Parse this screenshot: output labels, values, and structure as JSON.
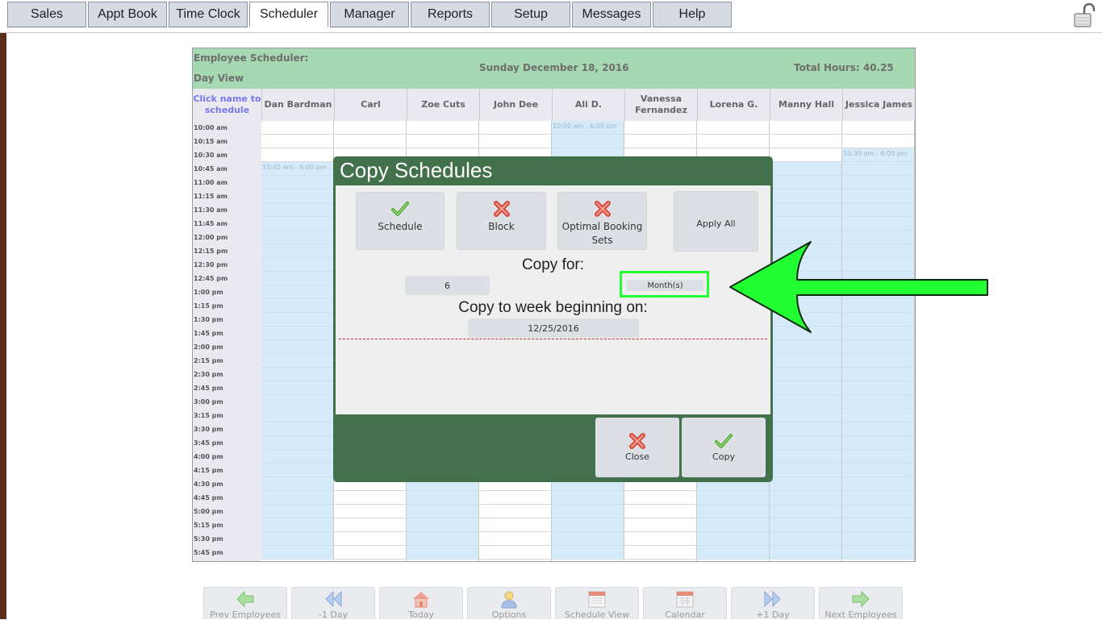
{
  "tabs": [
    {
      "label": "Sales"
    },
    {
      "label": "Appt Book"
    },
    {
      "label": "Time Clock"
    },
    {
      "label": "Scheduler",
      "active": true
    },
    {
      "label": "Manager"
    },
    {
      "label": "Reports"
    },
    {
      "label": "Setup"
    },
    {
      "label": "Messages"
    },
    {
      "label": "Help"
    }
  ],
  "scheduler": {
    "title_line1": "Employee Scheduler:",
    "title_line2": "Day View",
    "date": "Sunday December 18, 2016",
    "total_hours": "Total Hours: 40.25",
    "click_name_hint": "Click name to schedule",
    "employees": [
      "Dan Bardman",
      "Carl",
      "Zoe Cuts",
      "John Dee",
      "Ali D.",
      "Vanessa Fernandez",
      "Lorena G.",
      "Manny Hall",
      "Jessica James"
    ],
    "times": [
      "10:00 am",
      "10:15 am",
      "10:30 am",
      "10:45 am",
      "11:00 am",
      "11:15 am",
      "11:30 am",
      "11:45 am",
      "12:00 pm",
      "12:15 pm",
      "12:30 pm",
      "12:45 pm",
      "1:00 pm",
      "1:15 pm",
      "1:30 pm",
      "1:45 pm",
      "2:00 pm",
      "2:15 pm",
      "2:30 pm",
      "2:45 pm",
      "3:00 pm",
      "3:15 pm",
      "3:30 pm",
      "3:45 pm",
      "4:00 pm",
      "4:15 pm",
      "4:30 pm",
      "4:45 pm",
      "5:00 pm",
      "5:15 pm",
      "5:30 pm",
      "5:45 pm"
    ],
    "shifts": [
      {
        "employee": 0,
        "label": "10:45 am - 6:00 pm",
        "start": "10:45 am"
      },
      {
        "employee": 2,
        "label": "",
        "start": "10:45 am"
      },
      {
        "employee": 4,
        "label": "10:00 am - 6:00 pm",
        "start": "10:00 am"
      },
      {
        "employee": 6,
        "label": "",
        "start": "10:45 am"
      },
      {
        "employee": 7,
        "label": "",
        "start": "10:45 am"
      },
      {
        "employee": 8,
        "label": "10:30 am - 6:00 pm",
        "start": "10:30 am"
      }
    ]
  },
  "dialog": {
    "title": "Copy Schedules",
    "options": {
      "schedule": "Schedule",
      "block": "Block",
      "optimal_booking_line1": "Optimal Booking",
      "optimal_booking_line2": "Sets",
      "apply_all": "Apply All"
    },
    "copy_for_label": "Copy for:",
    "copy_for_value": "6",
    "copy_for_unit": "Month(s)",
    "copy_to_label": "Copy to week beginning on:",
    "copy_to_value": "12/25/2016",
    "close_label": "Close",
    "copy_label": "Copy"
  },
  "nav": {
    "prev_employees": "Prev Employees",
    "minus_day": "-1 Day",
    "today": "Today",
    "options": "Options",
    "schedule_view": "Schedule View",
    "calendar": "Calendar",
    "plus_day": "+1 Day",
    "next_employees": "Next Employees"
  },
  "colors": {
    "header_green": "#a6d8b1",
    "dialog_green": "#42714c",
    "highlight_green": "#22ff33",
    "shift_blue": "#c8e4f8"
  }
}
